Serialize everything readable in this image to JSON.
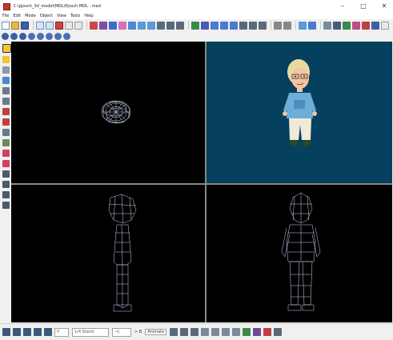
{
  "window": {
    "title": "C:\\pjosch_3d_model\\MDL\\Pjosch.MDL - med",
    "minimize_glyph": "–",
    "maximize_glyph": "□",
    "close_glyph": "✕"
  },
  "menu": {
    "items": [
      "File",
      "Edit",
      "Mode",
      "Object",
      "View",
      "Tools",
      "Help"
    ]
  },
  "viewports": {
    "top_left": {
      "view": "wireframe-top",
      "background": "#000000"
    },
    "top_right": {
      "view": "textured-perspective",
      "background": "#05405e"
    },
    "bottom_left": {
      "view": "wireframe-side",
      "background": "#000000"
    },
    "bottom_right": {
      "view": "wireframe-front",
      "background": "#000000"
    }
  },
  "status": {
    "frame_field": "0",
    "range_field": "1/4 Stand",
    "arrow_field": "→|",
    "pos_label": "> B",
    "mode_label": "Animate"
  },
  "colors": {
    "wire": "#c8d4ee",
    "viewport_divider": "#888888",
    "perspective_bg": "#05405e"
  }
}
